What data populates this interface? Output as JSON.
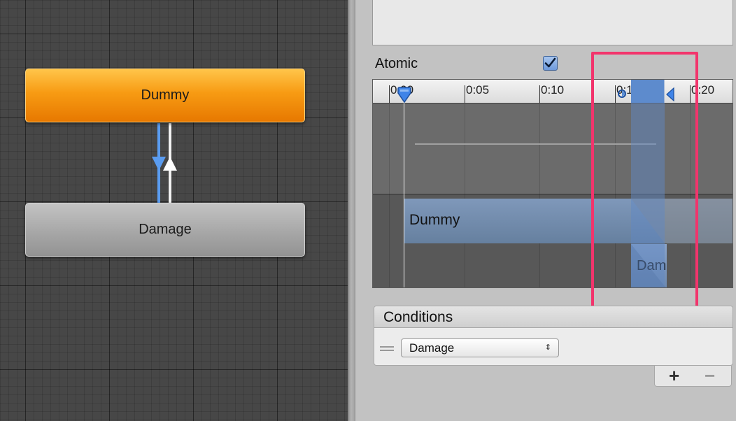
{
  "graph": {
    "states": [
      {
        "name": "Dummy",
        "color": "#f79b13"
      },
      {
        "name": "Damage",
        "color": "#a7a7a7"
      }
    ],
    "transition_colors": {
      "selected": "#5a9cf0",
      "other": "#ffffff"
    }
  },
  "inspector": {
    "atomic": {
      "label": "Atomic",
      "checked": true
    },
    "timeline": {
      "ticks": [
        "0:00",
        "0:05",
        "0:10",
        "0:15",
        "0:20"
      ],
      "source_state": "Dummy",
      "destination_state": "Dam",
      "transition_color": "#5b8fd6"
    },
    "conditions": {
      "header": "Conditions",
      "items": [
        {
          "parameter": "Damage"
        }
      ],
      "add_label": "+",
      "remove_label": "−"
    },
    "highlight_color": "#f2346c"
  }
}
